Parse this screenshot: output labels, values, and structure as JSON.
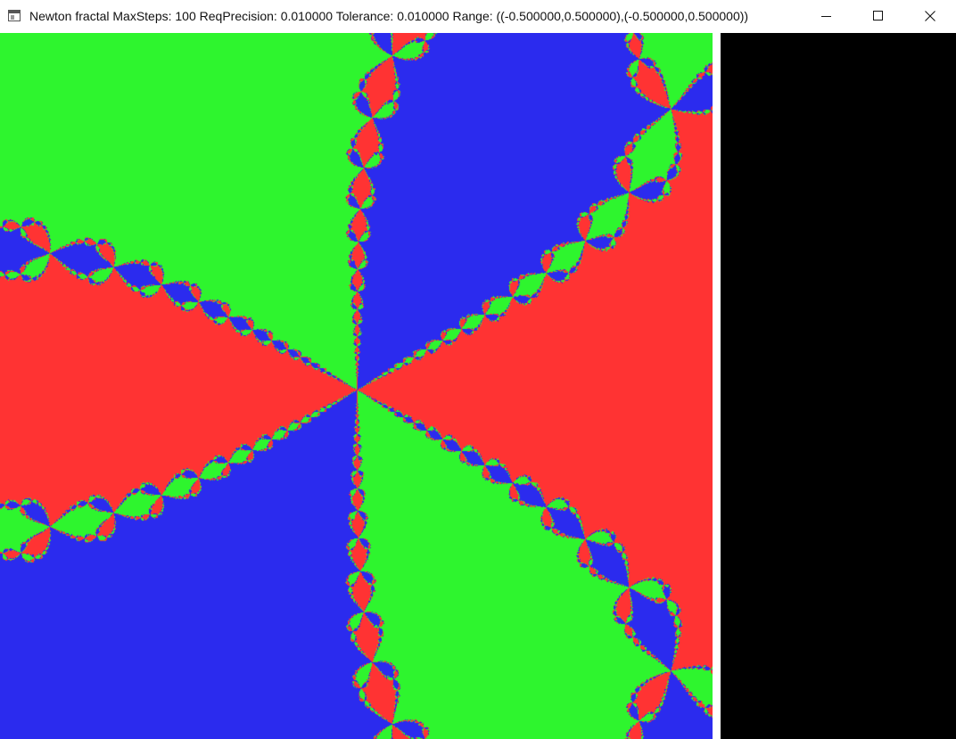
{
  "window": {
    "title": "Newton fractal MaxSteps: 100 ReqPrecision: 0.010000 Tolerance: 0.010000 Range: ((-0.500000,0.500000),(-0.500000,0.500000))",
    "icons": {
      "app": "app-window-icon",
      "minimize": "minimize-icon",
      "maximize": "maximize-icon",
      "close": "close-icon"
    }
  },
  "fractal": {
    "colors": {
      "red": "#ff3333",
      "green": "#2ef52e",
      "blue": "#2b2bee"
    }
  }
}
